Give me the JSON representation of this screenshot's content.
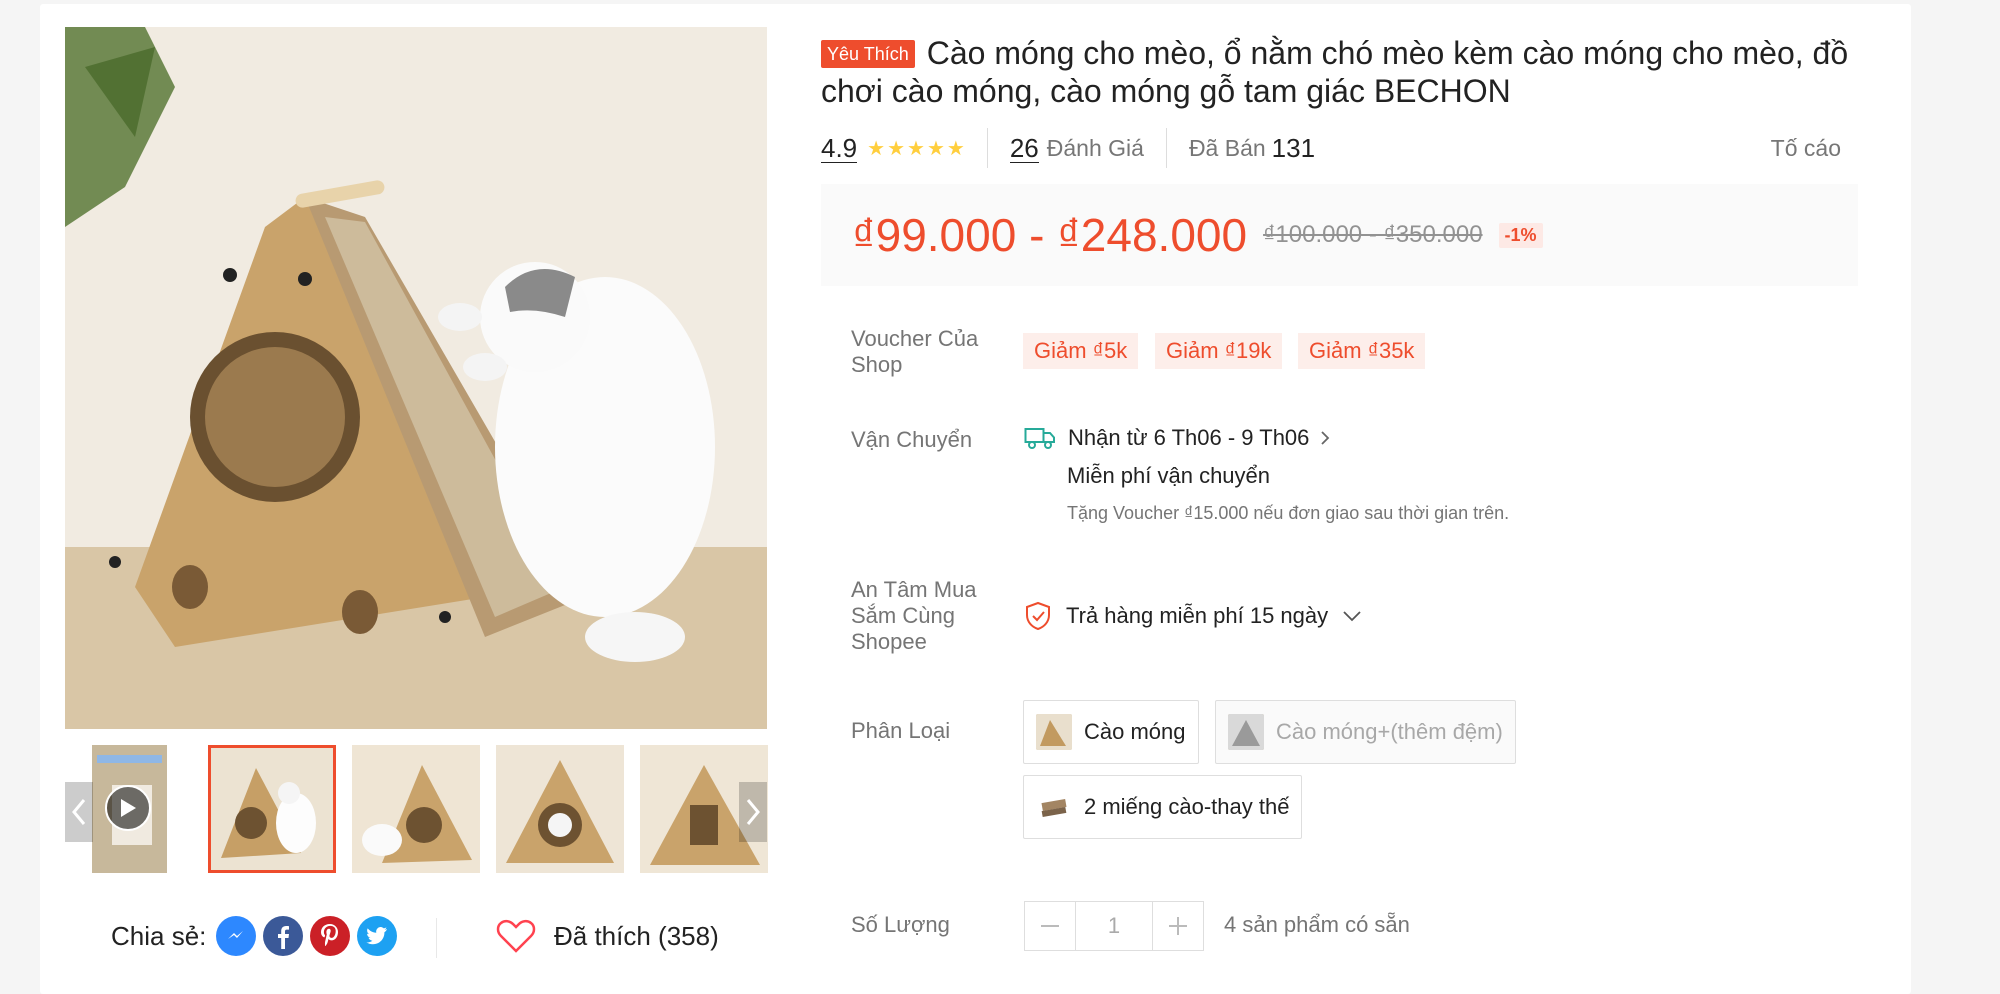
{
  "product": {
    "badge": "Yêu Thích",
    "title": "Cào móng cho mèo, ổ nằm chó mèo kèm cào móng cho mèo, đồ chơi cào móng, cào móng gỗ tam giác BECHON"
  },
  "stats": {
    "rating": "4.9",
    "stars": 5,
    "review_count": "26",
    "review_label": "Đánh Giá",
    "sold_label": "Đã Bán",
    "sold_count": "131",
    "report_label": "Tố cáo"
  },
  "price": {
    "current": "₫99.000 - ₫248.000",
    "original": "₫100.000 - ₫350.000",
    "discount": "-1%"
  },
  "voucher": {
    "label": "Voucher Của Shop",
    "tags": [
      "Giảm ₫5k",
      "Giảm ₫19k",
      "Giảm ₫35k"
    ]
  },
  "shipping": {
    "label": "Vận Chuyển",
    "delivery": "Nhận từ 6 Th06 - 9 Th06",
    "free": "Miễn phí vận chuyển",
    "note": "Tặng Voucher ₫15.000 nếu đơn giao sau thời gian trên."
  },
  "guarantee": {
    "label": "An Tâm Mua Sắm Cùng Shopee",
    "text": "Trả hàng miễn phí 15 ngày"
  },
  "variants": {
    "label": "Phân Loại",
    "options": [
      {
        "label": "Cào móng",
        "disabled": false
      },
      {
        "label": "Cào móng+(thêm đệm)",
        "disabled": true
      },
      {
        "label": "2 miếng cào-thay thế",
        "disabled": false
      }
    ]
  },
  "quantity": {
    "label": "Số Lượng",
    "value": "1",
    "stock": "4 sản phẩm có sẵn"
  },
  "share": {
    "label": "Chia sẻ:",
    "icons": [
      "messenger-icon",
      "facebook-icon",
      "pinterest-icon",
      "twitter-icon"
    ]
  },
  "like": {
    "label": "Đã thích (358)"
  },
  "colors": {
    "accent": "#ee4d2d",
    "star": "#ffce3d",
    "messenger": "#2d88ff",
    "facebook": "#3b5998",
    "pinterest": "#cb2027",
    "twitter": "#1da1f2"
  }
}
